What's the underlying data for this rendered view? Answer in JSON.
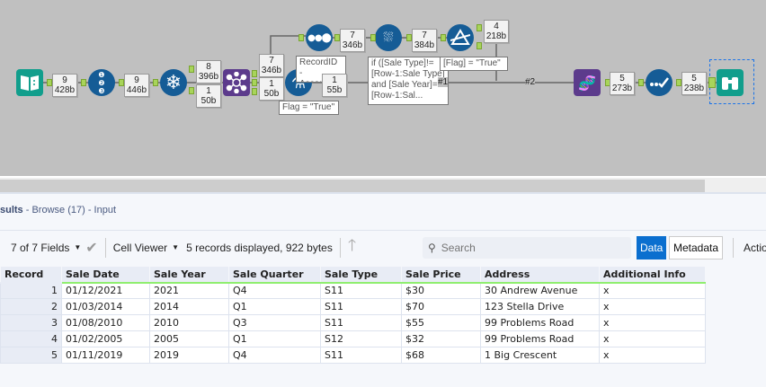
{
  "canvas": {
    "badges": [
      {
        "n": "9",
        "b": "428b"
      },
      {
        "n": "9",
        "b": "446b"
      },
      {
        "n": "8",
        "b": "396b"
      },
      {
        "n": "1",
        "b": "50b"
      },
      {
        "n": "7",
        "b": "346b"
      },
      {
        "n": "1",
        "b": "50b"
      },
      {
        "n": "1",
        "b": "55b"
      },
      {
        "n": "7",
        "b": "346b"
      },
      {
        "n": "7",
        "b": "384b"
      },
      {
        "n": "4",
        "b": "218b"
      },
      {
        "n": "5",
        "b": "273b"
      },
      {
        "n": "5",
        "b": "238b"
      }
    ],
    "annotations": {
      "sort": "RecordID - Ascending",
      "flag_formula": "Flag = \"True\"",
      "multirow": "if ([Sale Type]!=\n[Row-1:Sale Type]\nand [Sale Year]=\n[Row-1:Sal...",
      "filter": "[Flag] = \"True\""
    },
    "wire_labels": [
      "#1",
      "#2"
    ],
    "anchor_letters": {
      "u": "U",
      "b": "B",
      "j": "J",
      "l": "L",
      "r": "R",
      "t": "T",
      "f": "F"
    },
    "tools": [
      "input-book-icon",
      "record-id-icon",
      "transpose-icon",
      "join-icon",
      "formula-icon",
      "sort-icon",
      "multirow-formula-icon",
      "filter-icon",
      "dynamic-rename-icon",
      "select-icon",
      "browse-icon"
    ]
  },
  "results": {
    "title_bold": "sults",
    "title_rest": " - Browse (17) - Input",
    "fields": "7 of 7 Fields",
    "viewer": "Cell Viewer",
    "status": "5 records displayed, 922 bytes",
    "search_placeholder": "Search",
    "data_btn": "Data",
    "metadata_btn": "Metadata",
    "actions": "Actio",
    "accent": "#0b6fcf"
  },
  "table": {
    "columns": [
      "Record",
      "Sale Date",
      "Sale Year",
      "Sale Quarter",
      "Sale Type",
      "Sale Price",
      "Address",
      "Additional Info"
    ],
    "rows": [
      [
        "1",
        "01/12/2021",
        "2021",
        "Q4",
        "S11",
        "$30",
        "30 Andrew Avenue",
        "x"
      ],
      [
        "2",
        "01/03/2014",
        "2014",
        "Q1",
        "S11",
        "$70",
        "123 Stella Drive",
        "x"
      ],
      [
        "3",
        "01/08/2010",
        "2010",
        "Q3",
        "S11",
        "$55",
        "99 Problems Road",
        "x"
      ],
      [
        "4",
        "01/02/2005",
        "2005",
        "Q1",
        "S12",
        "$32",
        "99 Problems Road",
        "x"
      ],
      [
        "5",
        "01/11/2019",
        "2019",
        "Q4",
        "S11",
        "$68",
        "1 Big Crescent",
        "x"
      ]
    ]
  }
}
